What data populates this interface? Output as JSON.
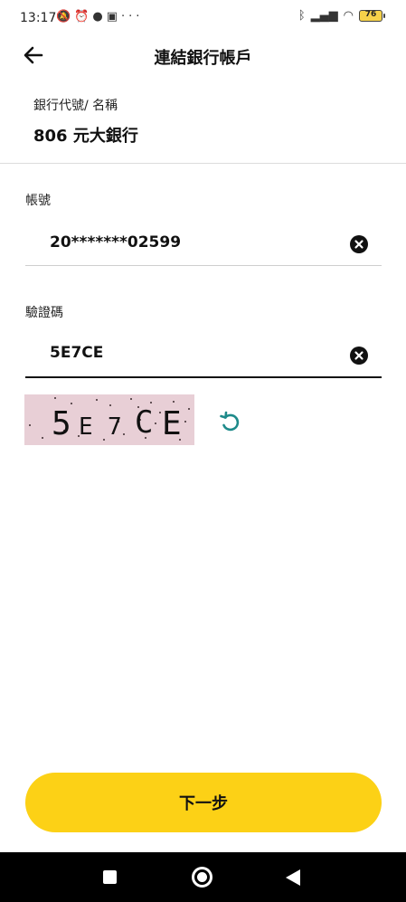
{
  "status_bar": {
    "time": "13:17",
    "left_icons": [
      "notification-off-icon",
      "alarm-icon",
      "messenger-icon",
      "teams-icon",
      "people-icon",
      "more-dots-icon"
    ],
    "right_icons": [
      "bluetooth-icon",
      "signal-icon",
      "wifi-icon"
    ],
    "battery_level": "76"
  },
  "header": {
    "title": "連結銀行帳戶",
    "back_icon": "arrow-left-icon"
  },
  "bank": {
    "label": "銀行代號/ 名稱",
    "value": "806 元大銀行"
  },
  "account": {
    "label": "帳號",
    "value": "20*******02599"
  },
  "captcha": {
    "label": "驗證碼",
    "value": "5E7CE",
    "image_text": [
      "5",
      "E",
      "7",
      "C",
      "E"
    ],
    "image_bg_color": "#e8cfd6",
    "refresh_icon_color": "#1e8a8a"
  },
  "actions": {
    "next_label": "下一步",
    "next_color": "#fcd116"
  },
  "nav": {
    "icons": [
      "recent-apps-icon",
      "home-icon",
      "back-triangle-icon"
    ]
  }
}
